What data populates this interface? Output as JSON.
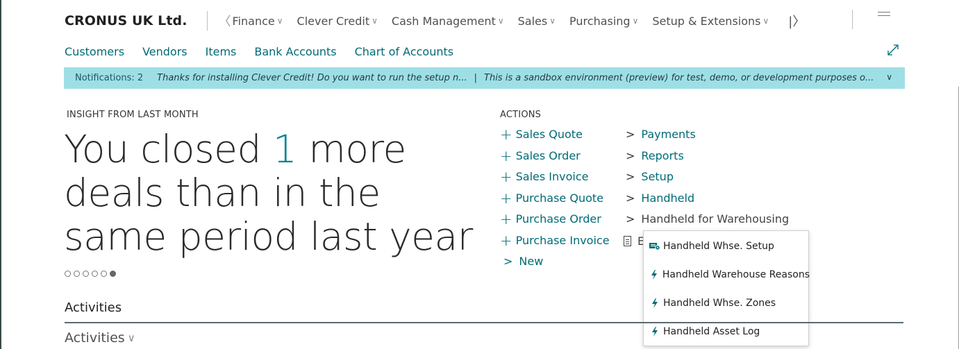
{
  "header": {
    "company": "CRONUS UK Ltd.",
    "nav": [
      {
        "label": "Finance"
      },
      {
        "label": "Clever Credit"
      },
      {
        "label": "Cash Management"
      },
      {
        "label": "Sales"
      },
      {
        "label": "Purchasing"
      },
      {
        "label": "Setup & Extensions"
      }
    ],
    "prev_icon": "chevron-left-icon",
    "next_icon": "chevron-right-icon",
    "menu_icon": "hamburger-icon"
  },
  "links": [
    "Customers",
    "Vendors",
    "Items",
    "Bank Accounts",
    "Chart of Accounts"
  ],
  "notification": {
    "count_label": "Notifications: 2",
    "message1": "Thanks for installing Clever Credit! Do you want to run the setup n...",
    "separator": "|",
    "message2": "This is a sandbox environment (preview) for test, demo, or development purposes o..."
  },
  "insight": {
    "label": "INSIGHT FROM LAST MONTH",
    "headline_pre": "You closed ",
    "headline_num": "1",
    "headline_post": " more deals than in the same period last year"
  },
  "actions": {
    "label": "ACTIONS",
    "left": [
      "Sales Quote",
      "Sales Order",
      "Sales Invoice",
      "Purchase Quote",
      "Purchase Order",
      "Purchase Invoice"
    ],
    "new_label": "New",
    "right": [
      "Payments",
      "Reports",
      "Setup",
      "Handheld",
      "Handheld for Warehousing"
    ],
    "partial_item": "E"
  },
  "dropdown": {
    "items": [
      {
        "label": "Handheld Whse. Setup",
        "icon": "setup-icon"
      },
      {
        "label": "Handheld Warehouse Reasons",
        "icon": "lightning-icon"
      },
      {
        "label": "Handheld Whse. Zones",
        "icon": "lightning-icon"
      },
      {
        "label": "Handheld Asset Log",
        "icon": "lightning-icon"
      }
    ]
  },
  "activities": {
    "title": "Activities",
    "subtitle": "Activities"
  },
  "carousel": {
    "count": 6,
    "active_index": 5
  },
  "colors": {
    "accent": "#006b76",
    "notification_bg": "#9edfe6",
    "headline_accent": "#00838f"
  }
}
